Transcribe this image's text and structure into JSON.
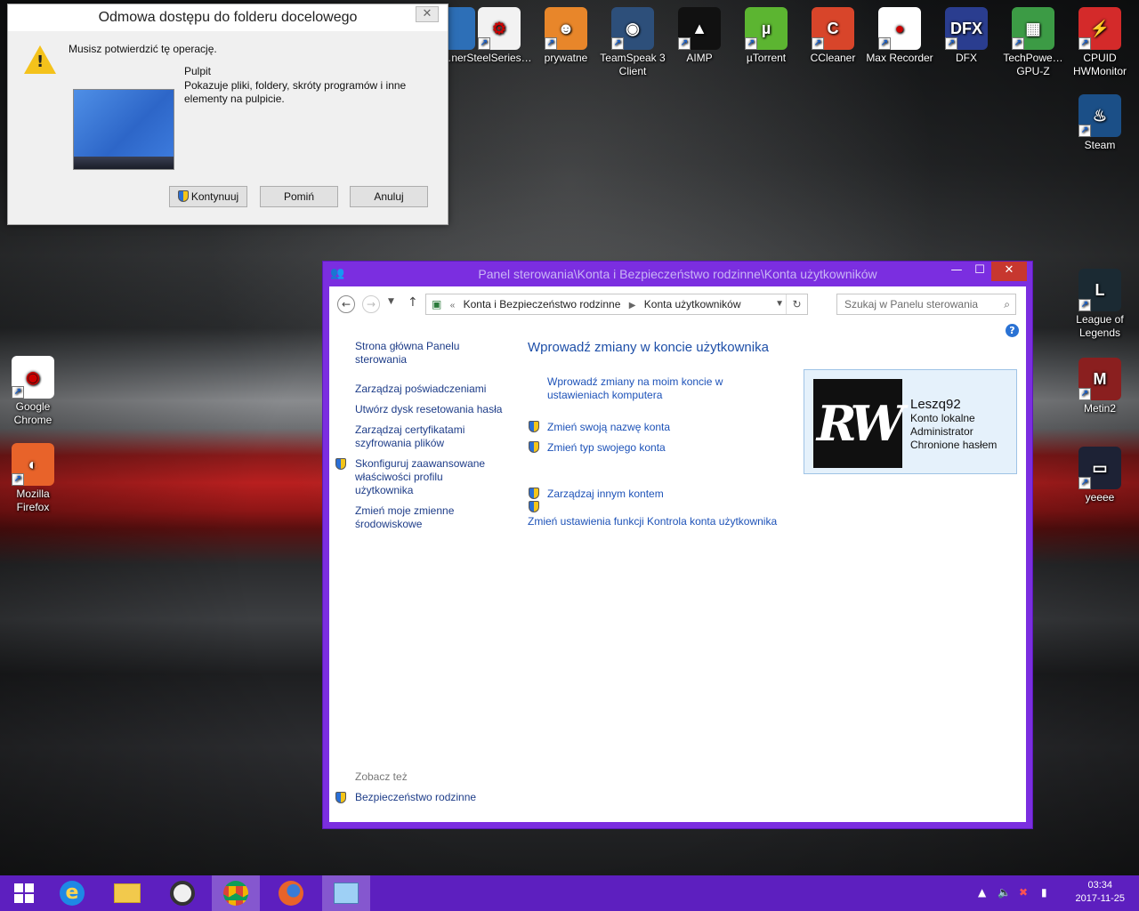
{
  "desktop_icons_top": [
    {
      "label": "…ner",
      "color": "#2d6fb7",
      "glyph": ""
    },
    {
      "label": "SteelSeries…",
      "color": "#f2f2f2",
      "glyph": "⚙"
    },
    {
      "label": "prywatne",
      "color": "#e8862a",
      "glyph": "☻"
    },
    {
      "label": "TeamSpeak 3 Client",
      "color": "#2d4f7a",
      "glyph": "◉"
    },
    {
      "label": "AIMP",
      "color": "#111111",
      "glyph": "▲"
    },
    {
      "label": "µTorrent",
      "color": "#5cb531",
      "glyph": "µ"
    },
    {
      "label": "CCleaner",
      "color": "#d8452a",
      "glyph": "C"
    },
    {
      "label": "Max Recorder",
      "color": "#ffffff",
      "glyph": "●"
    },
    {
      "label": "DFX",
      "color": "#2a3d8f",
      "glyph": "DFX"
    },
    {
      "label": "TechPowe… GPU-Z",
      "color": "#3c9b45",
      "glyph": "▦"
    },
    {
      "label": "CPUID HWMonitor",
      "color": "#d42a2a",
      "glyph": "⚡"
    }
  ],
  "desktop_icons_right": [
    {
      "label": "Steam",
      "color": "#1b4f87",
      "glyph": "♨"
    },
    {
      "label": "League of Legends",
      "color": "#1b2a33",
      "glyph": "L"
    },
    {
      "label": "Metin2",
      "color": "#8a1f1f",
      "glyph": "M"
    },
    {
      "label": "yeeee",
      "color": "#1d2235",
      "glyph": "▭"
    }
  ],
  "desktop_icons_left": [
    {
      "label": "Google Chrome",
      "color": "#ffffff",
      "glyph": "◉"
    },
    {
      "label": "Mozilla Firefox",
      "color": "#e8632a",
      "glyph": "◐"
    }
  ],
  "dialog": {
    "title": "Odmowa dostępu do folderu docelowego",
    "close": "✕",
    "message": "Musisz potwierdzić tę operację.",
    "folder_name": "Pulpit",
    "folder_desc": "Pokazuje pliki, foldery, skróty programów i inne elementy na pulpicie.",
    "btn_continue": "Kontynuuj",
    "btn_skip": "Pomiń",
    "btn_cancel": "Anuluj"
  },
  "window": {
    "title": "Panel sterowania\\Konta i Bezpieczeństwo rodzinne\\Konta użytkowników",
    "minimize": "—",
    "maximize": "☐",
    "close": "✕",
    "addr_prefix": "«",
    "addr_crumb1": "Konta i Bezpieczeństwo rodzinne",
    "addr_crumb2": "Konta użytkowników",
    "search_placeholder": "Szukaj w Panelu sterowania",
    "sidebar": {
      "home": "Strona główna Panelu sterowania",
      "item1": "Zarządzaj poświadczeniami",
      "item2": "Utwórz dysk resetowania hasła",
      "item3": "Zarządzaj certyfikatami szyfrowania plików",
      "item4": "Skonfiguruj zaawansowane właściwości profilu użytkownika",
      "item5": "Zmień moje zmienne środowiskowe"
    },
    "main_title": "Wprowadź zmiany w koncie użytkownika",
    "link1": "Wprowadź zmiany na moim koncie w ustawieniach komputera",
    "link2": "Zmień swoją nazwę konta",
    "link3": "Zmień typ swojego konta",
    "link4": "Zarządzaj innym kontem",
    "link5": "Zmień ustawienia funkcji Kontrola konta użytkownika",
    "account": {
      "name": "Leszq92",
      "type": "Konto lokalne",
      "role": "Administrator",
      "password": "Chronione hasłem",
      "avatar_text": "RW"
    },
    "see_also": "Zobacz też",
    "see_also_link": "Bezpieczeństwo rodzinne"
  },
  "taskbar": {
    "time": "03:34",
    "date": "2017-11-25"
  }
}
